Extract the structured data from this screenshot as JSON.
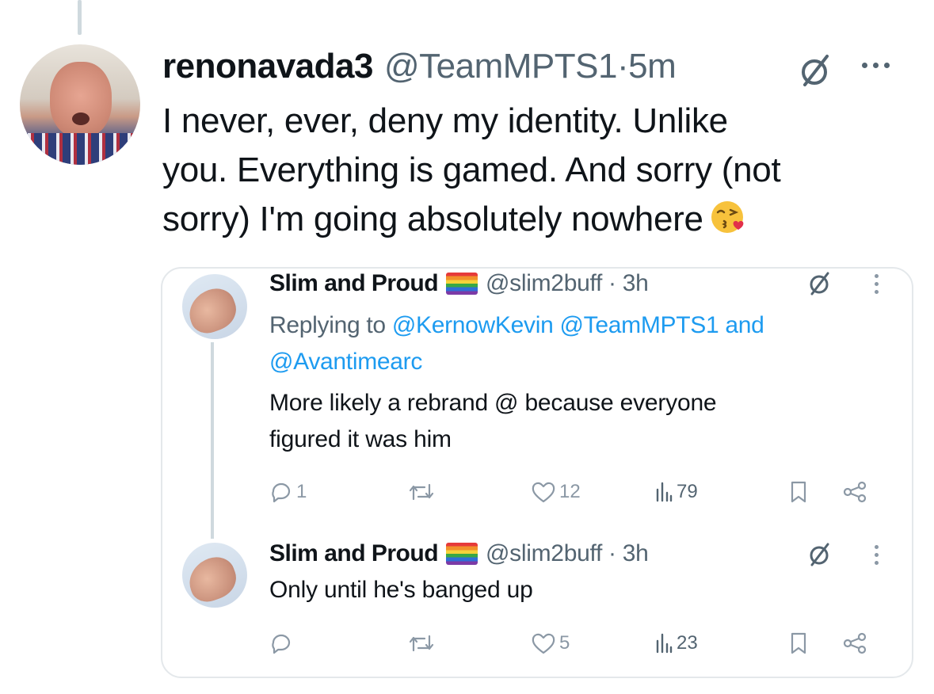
{
  "main_tweet": {
    "name": "renonavada3",
    "handle": "@TeamMPTS1",
    "separator": "·",
    "time": "5m",
    "text_lines": [
      "I never, ever, deny my identity. Unlike",
      "you. Everything is gamed. And sorry (not",
      "sorry) I'm going absolutely nowhere"
    ],
    "emoji": "face-blowing-a-kiss-emoji"
  },
  "quoted_thread": {
    "reply1": {
      "name": "Slim and Proud",
      "flag": "rainbow-flag-emoji",
      "handle": "@slim2buff",
      "separator": "·",
      "time": "3h",
      "replying_prefix": "Replying to",
      "mention1": "@KernowKevin",
      "mention2": "@TeamMPTS1",
      "and": "and",
      "mention3": "@Avantimearc",
      "text_lines": [
        "More likely a rebrand @ because everyone",
        "figured it was him"
      ],
      "actions": {
        "replies": "1",
        "retweets": "",
        "likes": "12",
        "views": "79"
      }
    },
    "reply2": {
      "name": "Slim and Proud",
      "flag": "rainbow-flag-emoji",
      "handle": "@slim2buff",
      "separator": "·",
      "time": "3h",
      "text": "Only until he's banged up",
      "actions": {
        "replies": "",
        "retweets": "",
        "likes": "5",
        "views": "23"
      }
    }
  },
  "colors": {
    "text": "#0f1419",
    "secondary": "#536471",
    "link": "#1d9bf0",
    "icon_gray": "#8b98a5",
    "border": "#e4e8eb"
  }
}
